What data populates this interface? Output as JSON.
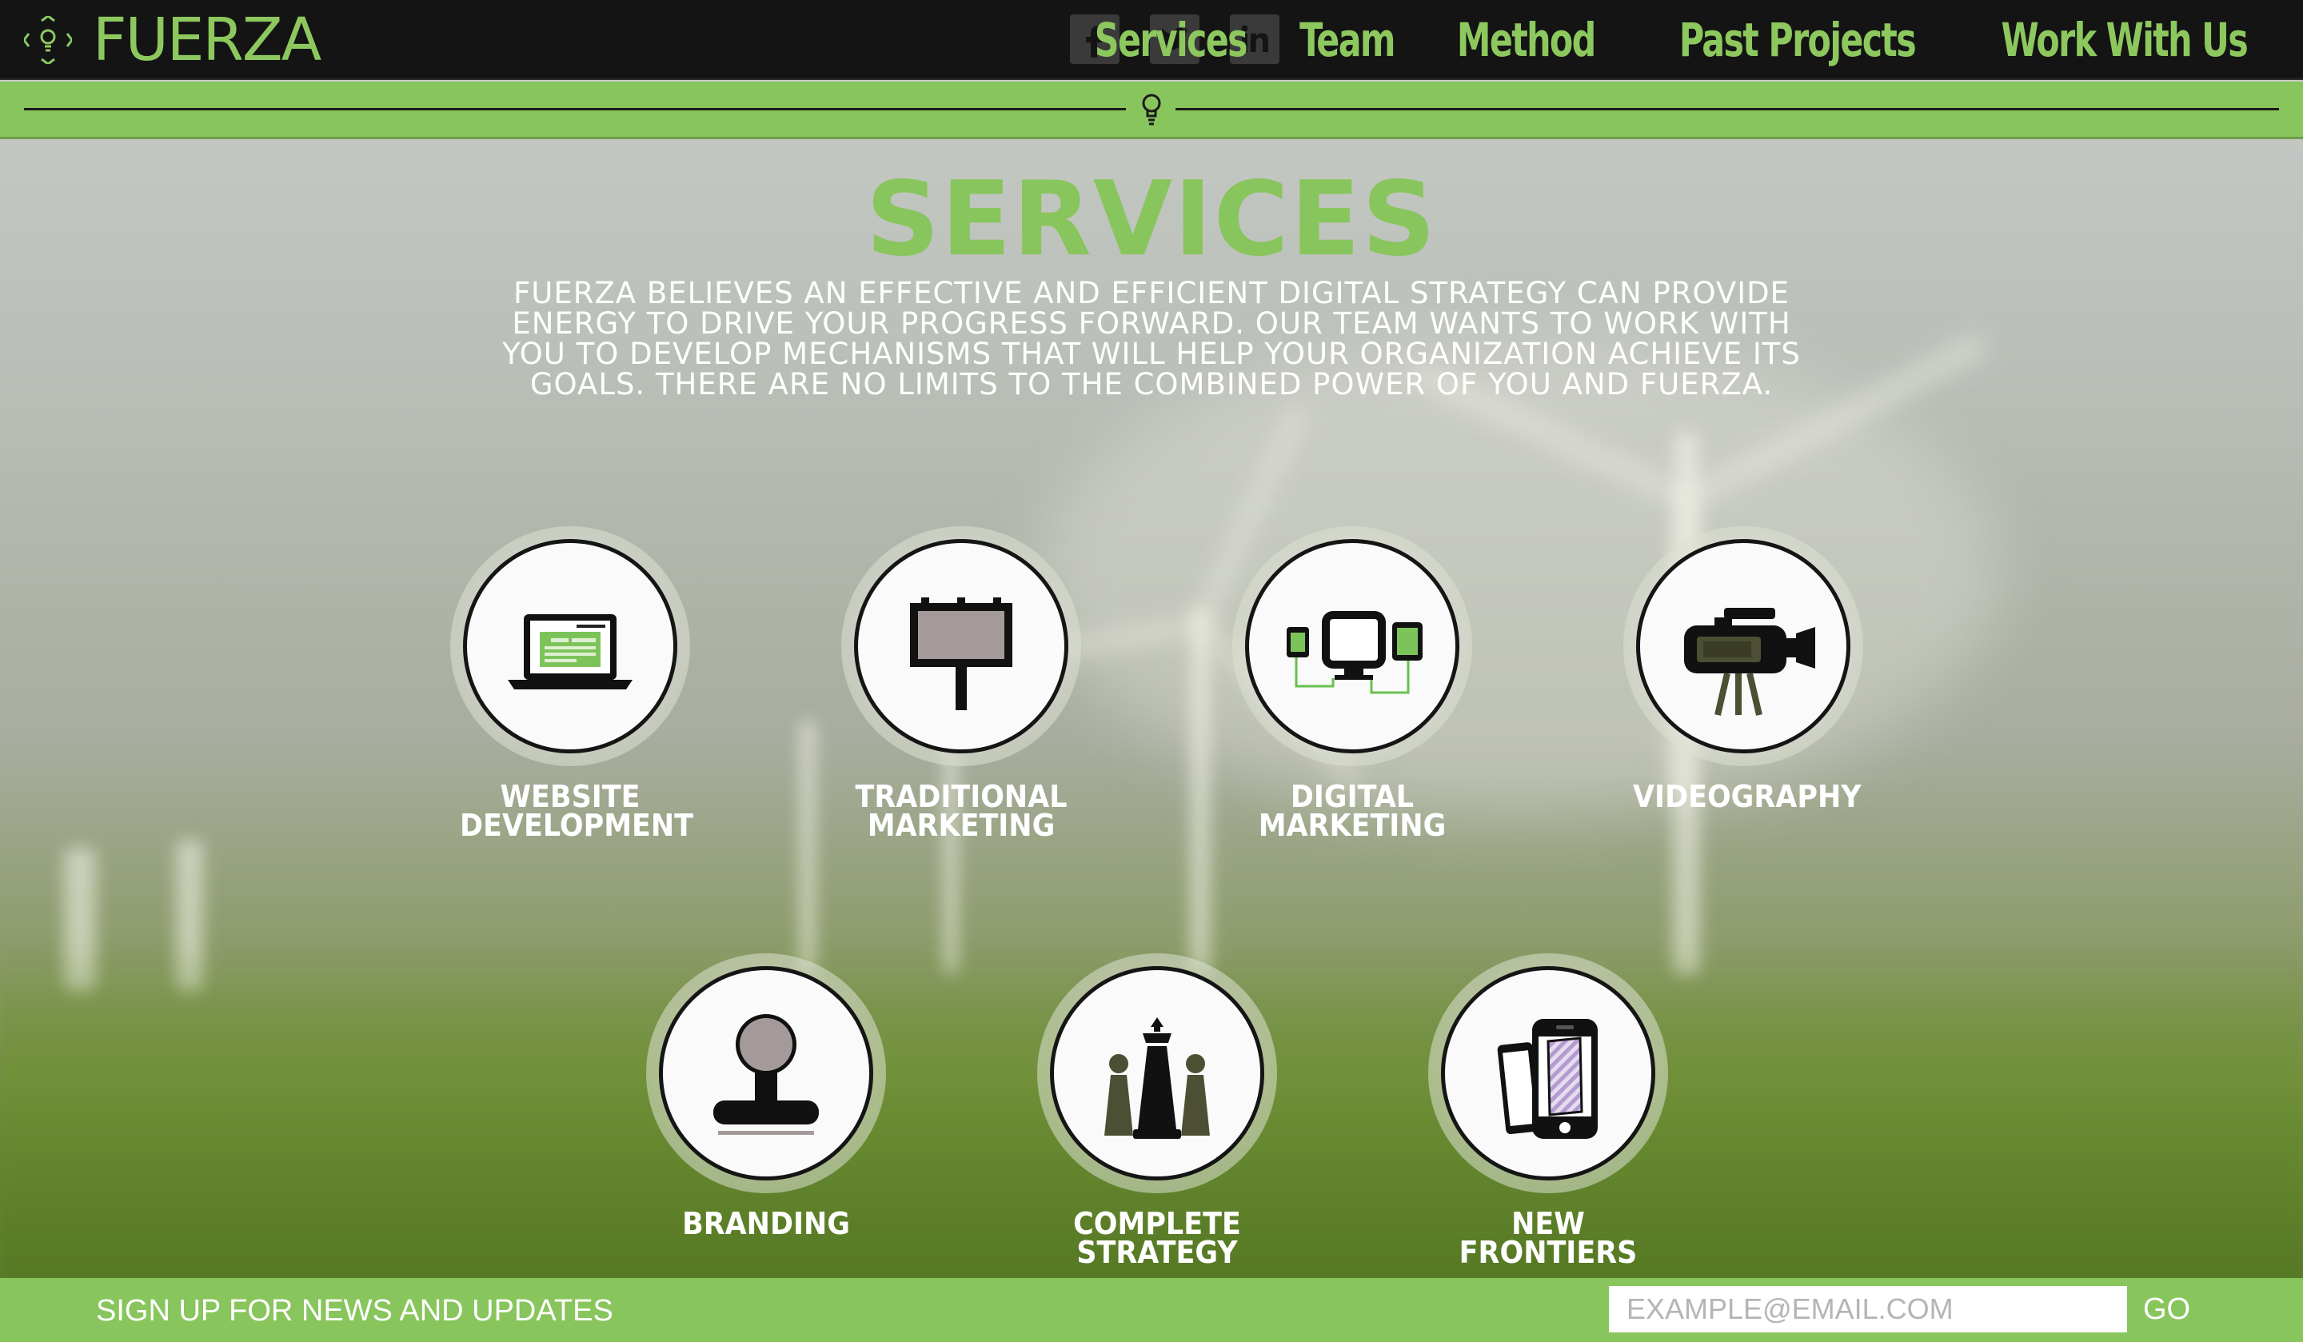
{
  "header": {
    "logo_text": "FUERZA",
    "social": [
      "facebook-icon",
      "twitter-icon",
      "linkedin-icon"
    ],
    "nav": [
      "Services",
      "Team",
      "Method",
      "Past Projects",
      "Work With Us"
    ]
  },
  "main": {
    "title": "Services",
    "intro": "Fuerza believes an effective and efficient digital strategy can provide energy to drive your progress forward. Our team wants to work with you to develop mechanisms that will help your organization achieve its goals. There are no limits to the combined power of you and Fuerza.",
    "services": [
      {
        "label": "Website Development",
        "icon": "laptop-icon"
      },
      {
        "label": "Traditional Marketing",
        "icon": "billboard-icon"
      },
      {
        "label": "Digital Marketing",
        "icon": "devices-icon"
      },
      {
        "label": "Videography",
        "icon": "video-camera-icon"
      },
      {
        "label": "Branding",
        "icon": "stamp-icon"
      },
      {
        "label": "Complete Strategy",
        "icon": "chess-icon"
      },
      {
        "label": "New Frontiers",
        "icon": "smartphone-icon"
      }
    ]
  },
  "footer": {
    "signup_text": "Sign up for news and updates",
    "email_placeholder": "EXAMPLE@EMAIL.COM",
    "go_label": "GO"
  },
  "colors": {
    "brand_green": "#88c55c",
    "header_bg": "#141414"
  }
}
